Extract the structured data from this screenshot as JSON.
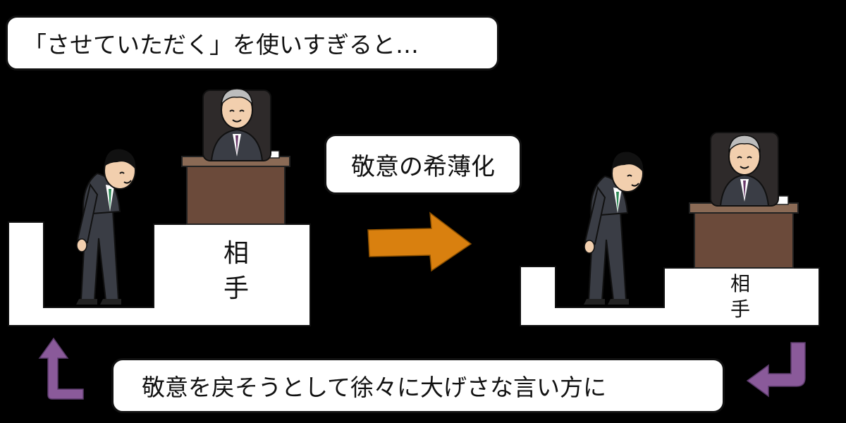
{
  "title": "「させていただく」を使いすぎると…",
  "middle_label": "敬意の希薄化",
  "bottom_label": "敬意を戻そうとして徐々に大げさな言い方に",
  "left_platform": {
    "label_line1": "相",
    "label_line2": "手"
  },
  "right_platform": {
    "label_line1": "相",
    "label_line2": "手"
  },
  "colors": {
    "arrow_main": "#d9800f",
    "arrow_side": "#8a5a9a",
    "desk": "#6b4a3a",
    "suit": "#3a3d45",
    "tie": "#2e8b57"
  }
}
